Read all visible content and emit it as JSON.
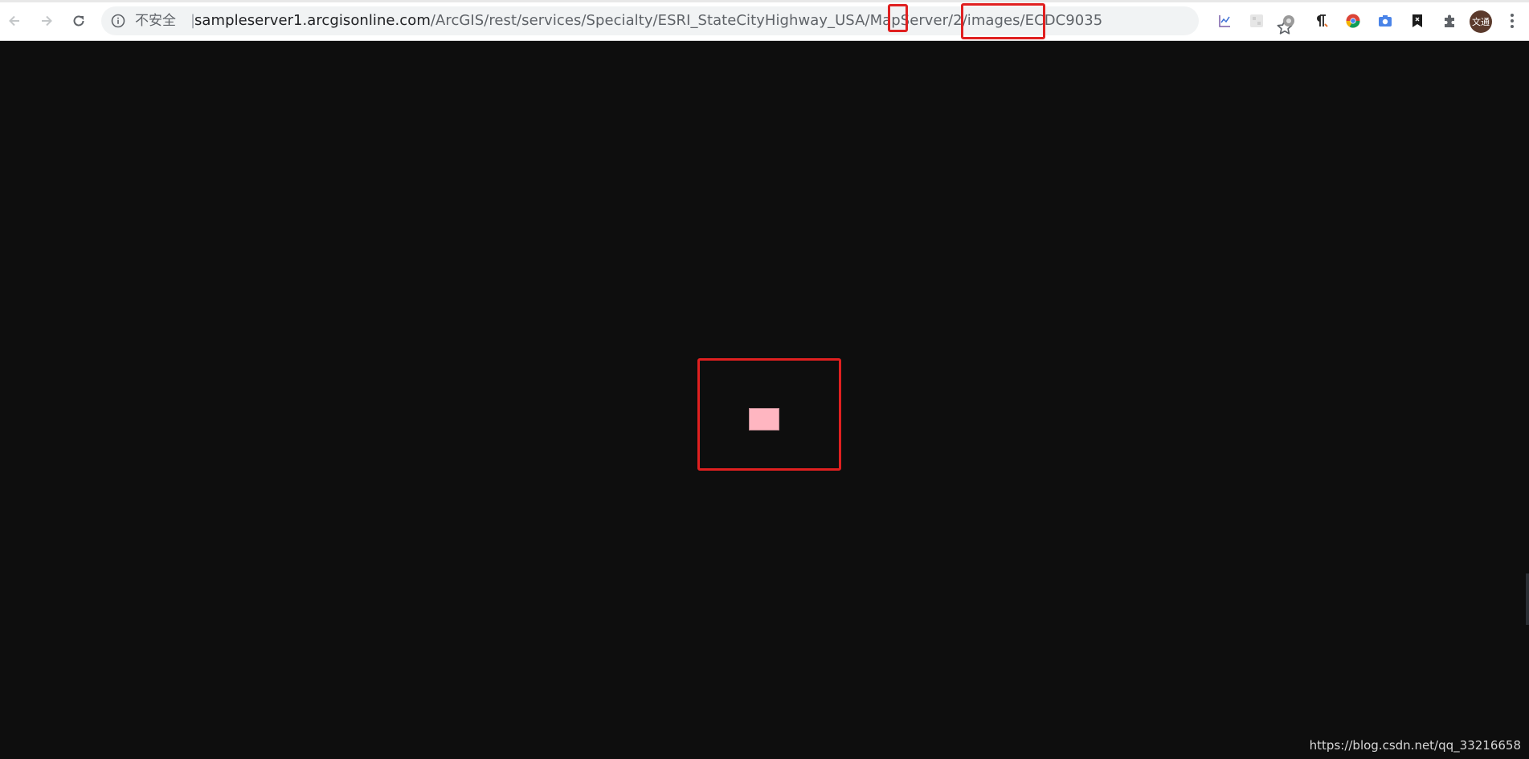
{
  "browser": {
    "security_label": "不安全",
    "separator": "|",
    "url_host": "sampleserver1.arcgisonline.com",
    "url_path_before": "/ArcGIS/rest/services/Specialty/ESRI_StateCityHighway_USA/MapServer/",
    "url_layer_id": "2",
    "url_path_mid": "/images/",
    "url_image_id": "ECDC9035",
    "avatar_text": "文通"
  },
  "icons": {
    "back": "arrow-left-icon",
    "forward": "arrow-right-icon",
    "reload": "reload-icon",
    "info": "info-icon",
    "star": "star-icon",
    "menu": "kebab-menu-icon"
  },
  "content": {
    "swatch_color": "#ffb6c1",
    "highlight_color": "#e02020"
  },
  "watermark": {
    "text": "https://blog.csdn.net/qq_33216658"
  }
}
